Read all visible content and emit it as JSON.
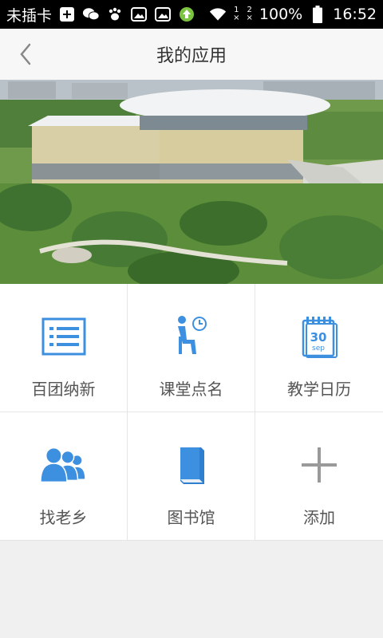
{
  "status_bar": {
    "carrier": "未插卡",
    "sim1": "1",
    "sim2": "2",
    "battery": "100%",
    "time": "16:52"
  },
  "header": {
    "title": "我的应用"
  },
  "apps": [
    {
      "label": "百团纳新",
      "icon": "list-icon"
    },
    {
      "label": "课堂点名",
      "icon": "seated-person-clock-icon"
    },
    {
      "label": "教学日历",
      "icon": "calendar-icon"
    },
    {
      "label": "找老乡",
      "icon": "people-group-icon"
    },
    {
      "label": "图书馆",
      "icon": "book-icon"
    },
    {
      "label": "添加",
      "icon": "plus-icon"
    }
  ],
  "calendar_icon": {
    "day": "30",
    "month": "sep"
  },
  "colors": {
    "accent": "#3d8fe0",
    "add_icon": "#999999",
    "background": "#f0f0f0"
  }
}
